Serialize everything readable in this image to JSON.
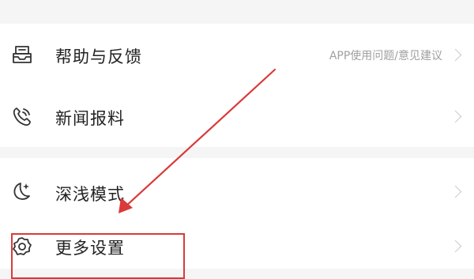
{
  "menu": {
    "items": [
      {
        "label": "帮助与反馈",
        "hint": "APP使用问题/意见建议",
        "icon": "feedback-icon"
      },
      {
        "label": "新闻报料",
        "hint": "",
        "icon": "phone-icon"
      },
      {
        "label": "深浅模式",
        "hint": "",
        "icon": "moon-icon"
      },
      {
        "label": "更多设置",
        "hint": "",
        "icon": "gear-icon"
      }
    ]
  },
  "annotation": {
    "color": "#d93a3a",
    "type": "arrow-and-box"
  }
}
